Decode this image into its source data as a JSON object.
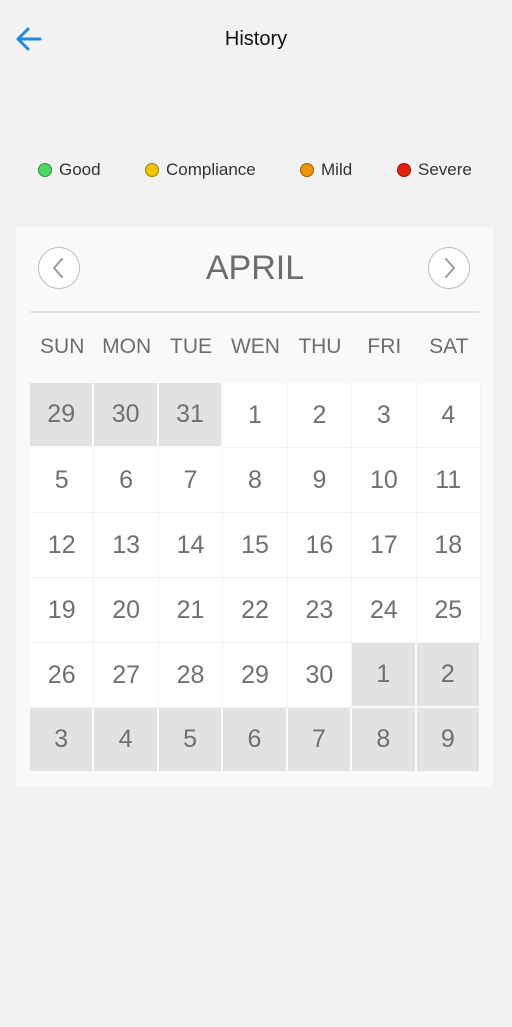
{
  "header": {
    "title": "History",
    "back_icon": "arrow-left-icon",
    "back_color": "#1e88e5"
  },
  "legend": [
    {
      "label": "Good",
      "color": "#4cd964"
    },
    {
      "label": "Compliance",
      "color": "#f2c500"
    },
    {
      "label": "Mild",
      "color": "#f09300"
    },
    {
      "label": "Severe",
      "color": "#e8200c"
    }
  ],
  "calendar": {
    "month": "APRIL",
    "prev_icon": "chevron-left-icon",
    "next_icon": "chevron-right-icon",
    "weekdays": [
      "SUN",
      "MON",
      "TUE",
      "WEN",
      "THU",
      "FRI",
      "SAT"
    ],
    "days": [
      {
        "label": "29",
        "current_month": false
      },
      {
        "label": "30",
        "current_month": false
      },
      {
        "label": "31",
        "current_month": false
      },
      {
        "label": "1",
        "current_month": true
      },
      {
        "label": "2",
        "current_month": true
      },
      {
        "label": "3",
        "current_month": true
      },
      {
        "label": "4",
        "current_month": true
      },
      {
        "label": "5",
        "current_month": true
      },
      {
        "label": "6",
        "current_month": true
      },
      {
        "label": "7",
        "current_month": true
      },
      {
        "label": "8",
        "current_month": true
      },
      {
        "label": "9",
        "current_month": true
      },
      {
        "label": "10",
        "current_month": true
      },
      {
        "label": "11",
        "current_month": true
      },
      {
        "label": "12",
        "current_month": true
      },
      {
        "label": "13",
        "current_month": true
      },
      {
        "label": "14",
        "current_month": true
      },
      {
        "label": "15",
        "current_month": true
      },
      {
        "label": "16",
        "current_month": true
      },
      {
        "label": "17",
        "current_month": true
      },
      {
        "label": "18",
        "current_month": true
      },
      {
        "label": "19",
        "current_month": true
      },
      {
        "label": "20",
        "current_month": true
      },
      {
        "label": "21",
        "current_month": true
      },
      {
        "label": "22",
        "current_month": true
      },
      {
        "label": "23",
        "current_month": true
      },
      {
        "label": "24",
        "current_month": true
      },
      {
        "label": "25",
        "current_month": true
      },
      {
        "label": "26",
        "current_month": true
      },
      {
        "label": "27",
        "current_month": true
      },
      {
        "label": "28",
        "current_month": true
      },
      {
        "label": "29",
        "current_month": true
      },
      {
        "label": "30",
        "current_month": true
      },
      {
        "label": "1",
        "current_month": false
      },
      {
        "label": "2",
        "current_month": false
      },
      {
        "label": "3",
        "current_month": false
      },
      {
        "label": "4",
        "current_month": false
      },
      {
        "label": "5",
        "current_month": false
      },
      {
        "label": "6",
        "current_month": false
      },
      {
        "label": "7",
        "current_month": false
      },
      {
        "label": "8",
        "current_month": false
      },
      {
        "label": "9",
        "current_month": false
      }
    ]
  }
}
